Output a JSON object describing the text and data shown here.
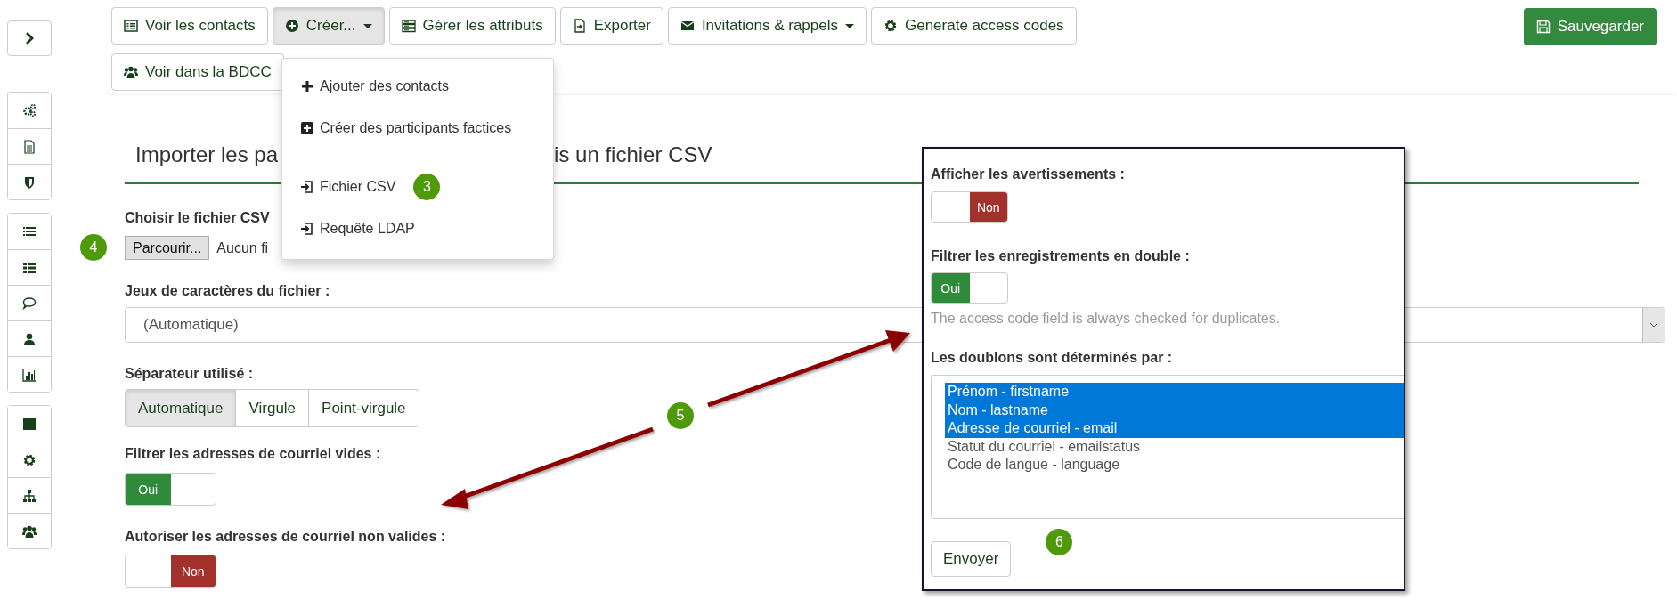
{
  "toolbar": {
    "buttons": [
      {
        "label": "Voir les contacts",
        "menu": false,
        "open": false
      },
      {
        "label": "Créer...",
        "menu": true,
        "open": true
      },
      {
        "label": "Gérer les attributs",
        "menu": false,
        "open": false
      },
      {
        "label": "Exporter",
        "menu": false,
        "open": false
      },
      {
        "label": "Invitations & rappels",
        "menu": true,
        "open": false
      },
      {
        "label": "Generate access codes",
        "menu": false,
        "open": false
      },
      {
        "label": "Voir dans la BDCC",
        "menu": false,
        "open": false
      }
    ],
    "save": "Sauvegarder"
  },
  "create_menu": {
    "items": [
      {
        "kind": "item",
        "label": "Ajouter des contacts"
      },
      {
        "kind": "item",
        "label": "Créer des participants factices"
      },
      {
        "kind": "divider"
      },
      {
        "kind": "item",
        "label": "Fichier CSV",
        "badge": "3"
      },
      {
        "kind": "item",
        "label": "Requête LDAP"
      }
    ]
  },
  "heading": {
    "start": "Importer les pa",
    "end": "is un fichier CSV"
  },
  "file": {
    "label": "Choisir le fichier CSV",
    "button": "Parcourir...",
    "status": "Aucun fi",
    "badge": "4"
  },
  "charset": {
    "label": "Jeux de caractères du fichier :",
    "value": "(Automatique)"
  },
  "separator": {
    "label": "Séparateur utilisé :",
    "options": [
      {
        "label": "Automatique",
        "selected": true
      },
      {
        "label": "Virgule",
        "selected": false
      },
      {
        "label": "Point-virgule",
        "selected": false
      }
    ]
  },
  "filter_empty": {
    "label": "Filtrer les adresses de courriel vides :",
    "on": true,
    "text": "Oui"
  },
  "allow_invalid": {
    "label": "Autoriser les adresses de courriel non valides :",
    "on": false,
    "text": "Non"
  },
  "callout": {
    "badge": "5"
  },
  "panel": {
    "warnings": {
      "label": "Afficher les avertissements :",
      "on": false,
      "text": "Non"
    },
    "duplicates": {
      "label": "Filtrer les enregistrements en double :",
      "on": true,
      "text": "Oui"
    },
    "help": "The access code field is always checked for duplicates.",
    "fields_label": "Les doublons sont déterminés par :",
    "fields": [
      {
        "label": "Prénom - firstname",
        "selected": true
      },
      {
        "label": "Nom - lastname",
        "selected": true
      },
      {
        "label": "Adresse de courriel - email",
        "selected": true
      },
      {
        "label": "Statut du courriel - emailstatus",
        "selected": false
      },
      {
        "label": "Code de langue - language",
        "selected": false
      }
    ],
    "submit": "Envoyer",
    "badge": "6"
  }
}
